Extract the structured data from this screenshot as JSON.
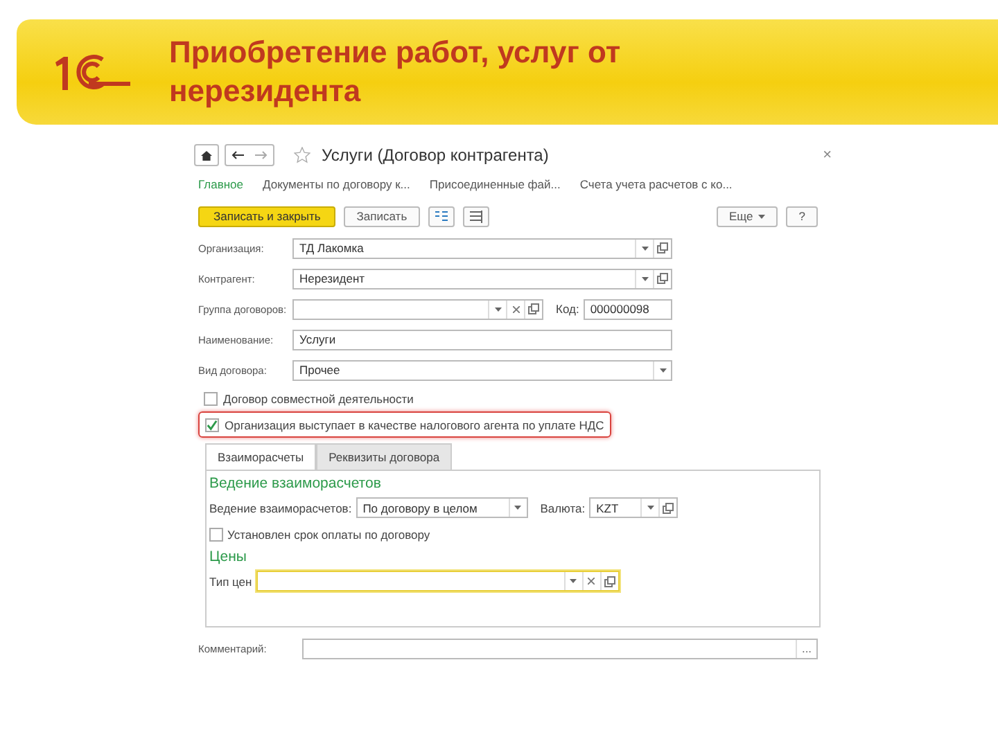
{
  "slide": {
    "title": "Приобретение работ, услуг от нерезидента"
  },
  "form": {
    "title": "Услуги (Договор контрагента)",
    "close": "×",
    "sections": [
      {
        "label": "Главное",
        "selected": true
      },
      {
        "label": "Документы по договору к...",
        "selected": false
      },
      {
        "label": "Присоединенные фай...",
        "selected": false
      },
      {
        "label": "Счета учета расчетов с ко...",
        "selected": false
      }
    ],
    "toolbar": {
      "primary": "Записать и закрыть",
      "save": "Записать",
      "more": "Еще",
      "help": "?"
    },
    "rows": [
      {
        "kind": "field",
        "label": "Организация:",
        "value": "ТД Лакомка",
        "dropdown": true,
        "open": true
      },
      {
        "kind": "field",
        "label": "Контрагент:",
        "value": "Нерезидент",
        "dropdown": true,
        "open": true
      },
      {
        "kind": "group",
        "label": "Группа договоров:",
        "dropdown": true,
        "clear": true,
        "open": true,
        "code_label": "Код:",
        "code_value": "000000098"
      },
      {
        "kind": "field",
        "label": "Наименование:",
        "value": "Услуги"
      },
      {
        "kind": "field",
        "label": "Вид договора:",
        "value": "Прочее",
        "dropdown": true
      },
      {
        "kind": "checkbox",
        "label": "Договор совместной деятельности",
        "checked": false,
        "highlighted": false
      },
      {
        "kind": "checkbox",
        "label": "Организация выступает в качестве налогового агента по уплате НДС",
        "checked": true,
        "highlighted": true
      }
    ],
    "tabs": [
      {
        "label": "Взаиморасчеты",
        "selected": true
      },
      {
        "label": "Реквизиты договора",
        "selected": false
      }
    ],
    "panel": {
      "heading": "Ведение взаиморасчетов",
      "settlement": {
        "label": "Ведение взаиморасчетов:",
        "value": "По договору в целом",
        "dropdown": true
      },
      "currency": {
        "label": "Валюта:",
        "value": "KZT",
        "dropdown": true,
        "open": true
      },
      "payment_term": {
        "label": "Установлен срок оплаты по договору",
        "checked": false
      },
      "prices_heading": "Цены",
      "price_type": {
        "label": "Тип цен",
        "focused": true,
        "dropdown": true,
        "clear": true,
        "open": true
      }
    },
    "comment": {
      "label": "Комментарий:",
      "button": "..."
    }
  }
}
